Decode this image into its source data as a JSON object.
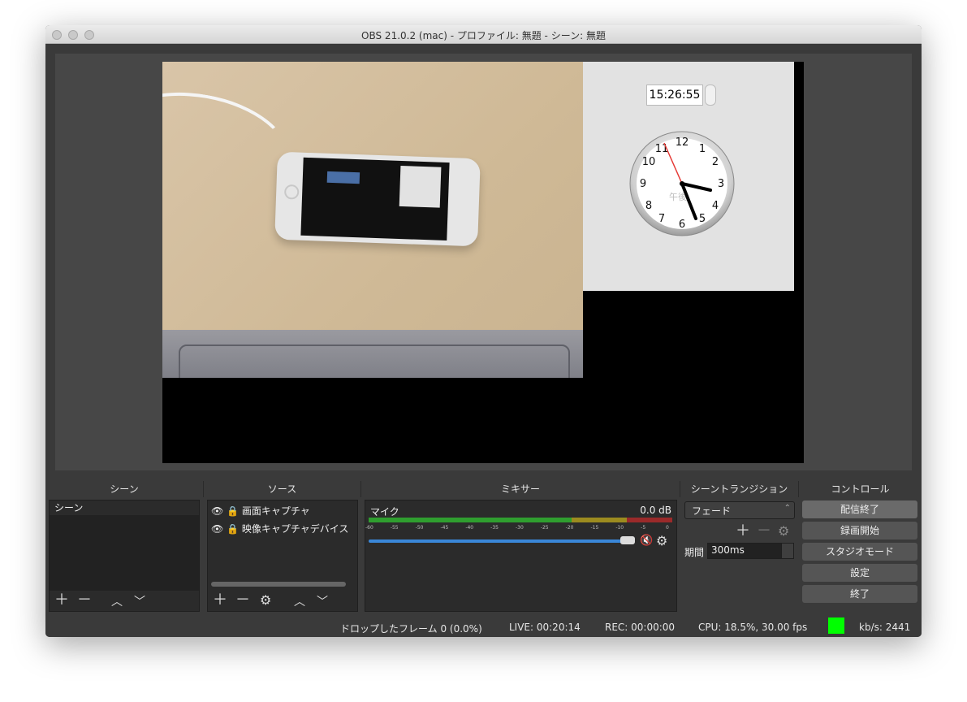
{
  "window": {
    "title": "OBS 21.0.2 (mac) - プロファイル: 無題 - シーン: 無題"
  },
  "preview": {
    "clock_time": "15:26:55",
    "clock_numbers": [
      "12",
      "1",
      "2",
      "3",
      "4",
      "5",
      "6",
      "7",
      "8",
      "9",
      "10",
      "11"
    ],
    "am_pm_label": "午後"
  },
  "docks": {
    "scenes": "シーン",
    "sources": "ソース",
    "mixer": "ミキサー",
    "transitions": "シーントランジション",
    "controls": "コントロール"
  },
  "scenes": {
    "items": [
      "シーン"
    ]
  },
  "sources": {
    "items": [
      "画面キャプチャ",
      "映像キャプチャデバイス"
    ]
  },
  "mixer": {
    "channel": "マイク",
    "db": "0.0 dB",
    "scale": [
      "-60",
      "-55",
      "-50",
      "-45",
      "-40",
      "-35",
      "-30",
      "-25",
      "-20",
      "-15",
      "-10",
      "-5",
      "0"
    ],
    "volume_level": 1.0
  },
  "transition": {
    "type": "フェード",
    "duration_label": "期間",
    "duration": "300ms"
  },
  "controls": {
    "stop_stream": "配信終了",
    "start_record": "録画開始",
    "studio_mode": "スタジオモード",
    "settings": "設定",
    "exit": "終了"
  },
  "statusbar": {
    "dropped": "ドロップしたフレーム 0 (0.0%)",
    "live": "LIVE: 00:20:14",
    "rec": "REC: 00:00:00",
    "cpu": "CPU: 18.5%, 30.00 fps",
    "kbps": "kb/s: 2441",
    "indicator_color": "#00ff00"
  },
  "colors": {
    "accent": "#3a87d8",
    "meter_green": "#2f9e2f",
    "meter_yellow": "#9c8b1f",
    "meter_red": "#9b2a2a",
    "mute_red": "#e12a2a"
  }
}
